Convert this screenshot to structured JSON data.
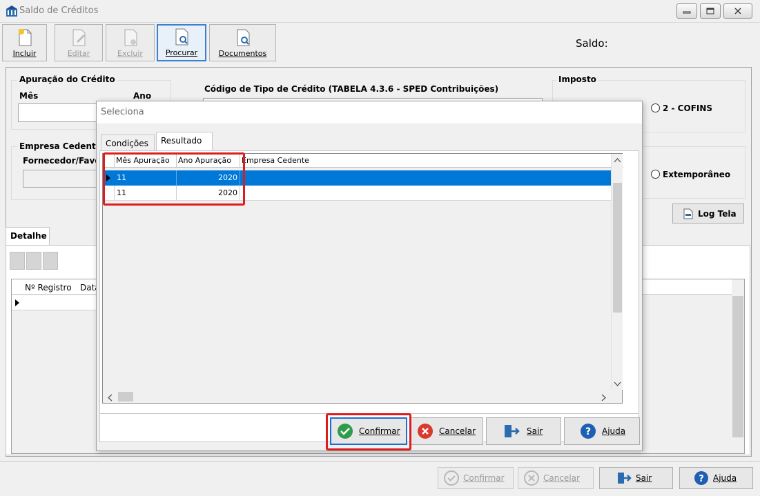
{
  "window": {
    "title": "Saldo de Créditos"
  },
  "toolbar": {
    "incluir": "Incluir",
    "editar": "Editar",
    "excluir": "Excluir",
    "procurar": "Procurar",
    "documentos": "Documentos"
  },
  "saldo_label": "Saldo:",
  "form": {
    "apuracao_title": "Apuração do Crédito",
    "mes_label": "Mês",
    "ano_label": "Ano",
    "codigo_tipo_label": "Código de Tipo de Crédito (TABELA 4.3.6 -  SPED Contribuições)",
    "imposto_title": "Imposto",
    "cofins_label": "2 - COFINS",
    "empresa_cedente_title": "Empresa Cedente",
    "fornecedor_label": "Fornecedor/Favo",
    "extemporaneo_label": "Extemporâneo",
    "log_tela": "Log Tela"
  },
  "detalhe": {
    "tab_label": "Detalhe",
    "col_registro": "Nº Registro",
    "col_data": "Data"
  },
  "dialog": {
    "title": "Seleciona",
    "tabs": [
      "Condições",
      "Resultado"
    ],
    "columns": [
      "Mês Apuração",
      "Ano Apuração",
      "Empresa Cedente"
    ],
    "rows": [
      {
        "mes": "11",
        "ano": "2020",
        "empresa": ""
      },
      {
        "mes": "11",
        "ano": "2020",
        "empresa": ""
      }
    ],
    "buttons": {
      "confirmar": "Confirmar",
      "cancelar": "Cancelar",
      "sair": "Sair",
      "ajuda": "Ajuda"
    }
  },
  "bottom": {
    "confirmar": "Confirmar",
    "cancelar": "Cancelar",
    "sair": "Sair",
    "ajuda": "Ajuda"
  },
  "colors": {
    "selection": "#0078d7",
    "highlight": "#e01b1b",
    "focus_border": "#1b6fd1"
  }
}
